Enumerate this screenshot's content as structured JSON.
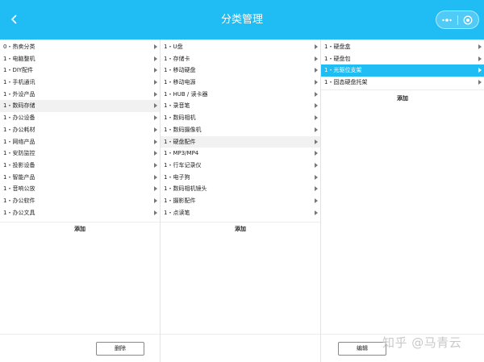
{
  "header": {
    "title": "分类管理",
    "back_icon": "chevron-left-icon",
    "more_icon": "more-dots-icon",
    "close_icon": "target-circle-icon"
  },
  "column1": {
    "items": [
      {
        "label": "0・热卖分类",
        "selected": false
      },
      {
        "label": "1・电脑整机",
        "selected": false
      },
      {
        "label": "1・DIY配件",
        "selected": false
      },
      {
        "label": "1・手机通讯",
        "selected": false
      },
      {
        "label": "1・外设产品",
        "selected": false
      },
      {
        "label": "1・数码存储",
        "selected": true
      },
      {
        "label": "1・办公设备",
        "selected": false
      },
      {
        "label": "1・办公耗材",
        "selected": false
      },
      {
        "label": "1・网络产品",
        "selected": false
      },
      {
        "label": "1・安防监控",
        "selected": false
      },
      {
        "label": "1・投影设备",
        "selected": false
      },
      {
        "label": "1・智能产品",
        "selected": false
      },
      {
        "label": "1・音响公放",
        "selected": false
      },
      {
        "label": "1・办公软件",
        "selected": false
      },
      {
        "label": "1・办公文具",
        "selected": false
      }
    ],
    "add_label": "添加"
  },
  "column2": {
    "items": [
      {
        "label": "1・U盘",
        "selected": false
      },
      {
        "label": "1・存储卡",
        "selected": false
      },
      {
        "label": "1・移动硬盘",
        "selected": false
      },
      {
        "label": "1・移动电源",
        "selected": false
      },
      {
        "label": "1・HUB / 读卡器",
        "selected": false
      },
      {
        "label": "1・录音笔",
        "selected": false
      },
      {
        "label": "1・数码相机",
        "selected": false
      },
      {
        "label": "1・数码摄像机",
        "selected": false
      },
      {
        "label": "1・硬盘配件",
        "selected": true
      },
      {
        "label": "1・MP3/MP4",
        "selected": false
      },
      {
        "label": "1・行车记录仪",
        "selected": false
      },
      {
        "label": "1・电子狗",
        "selected": false
      },
      {
        "label": "1・数码相机镜头",
        "selected": false
      },
      {
        "label": "1・摄影配件",
        "selected": false
      },
      {
        "label": "1・点读笔",
        "selected": false
      }
    ],
    "add_label": "添加"
  },
  "column3": {
    "items": [
      {
        "label": "1・硬盘盒",
        "selected": false
      },
      {
        "label": "1・硬盘包",
        "selected": false
      },
      {
        "label": "1・光驱位支架",
        "selected": true
      },
      {
        "label": "1・固态硬盘托架",
        "selected": false
      }
    ],
    "add_label": "添加"
  },
  "footer": {
    "delete_label": "删除",
    "edit_label": "编辑"
  },
  "watermark": "知乎 @马青云",
  "colors": {
    "accent": "#1fbdf3",
    "selected_grey": "#f1f1f1"
  }
}
